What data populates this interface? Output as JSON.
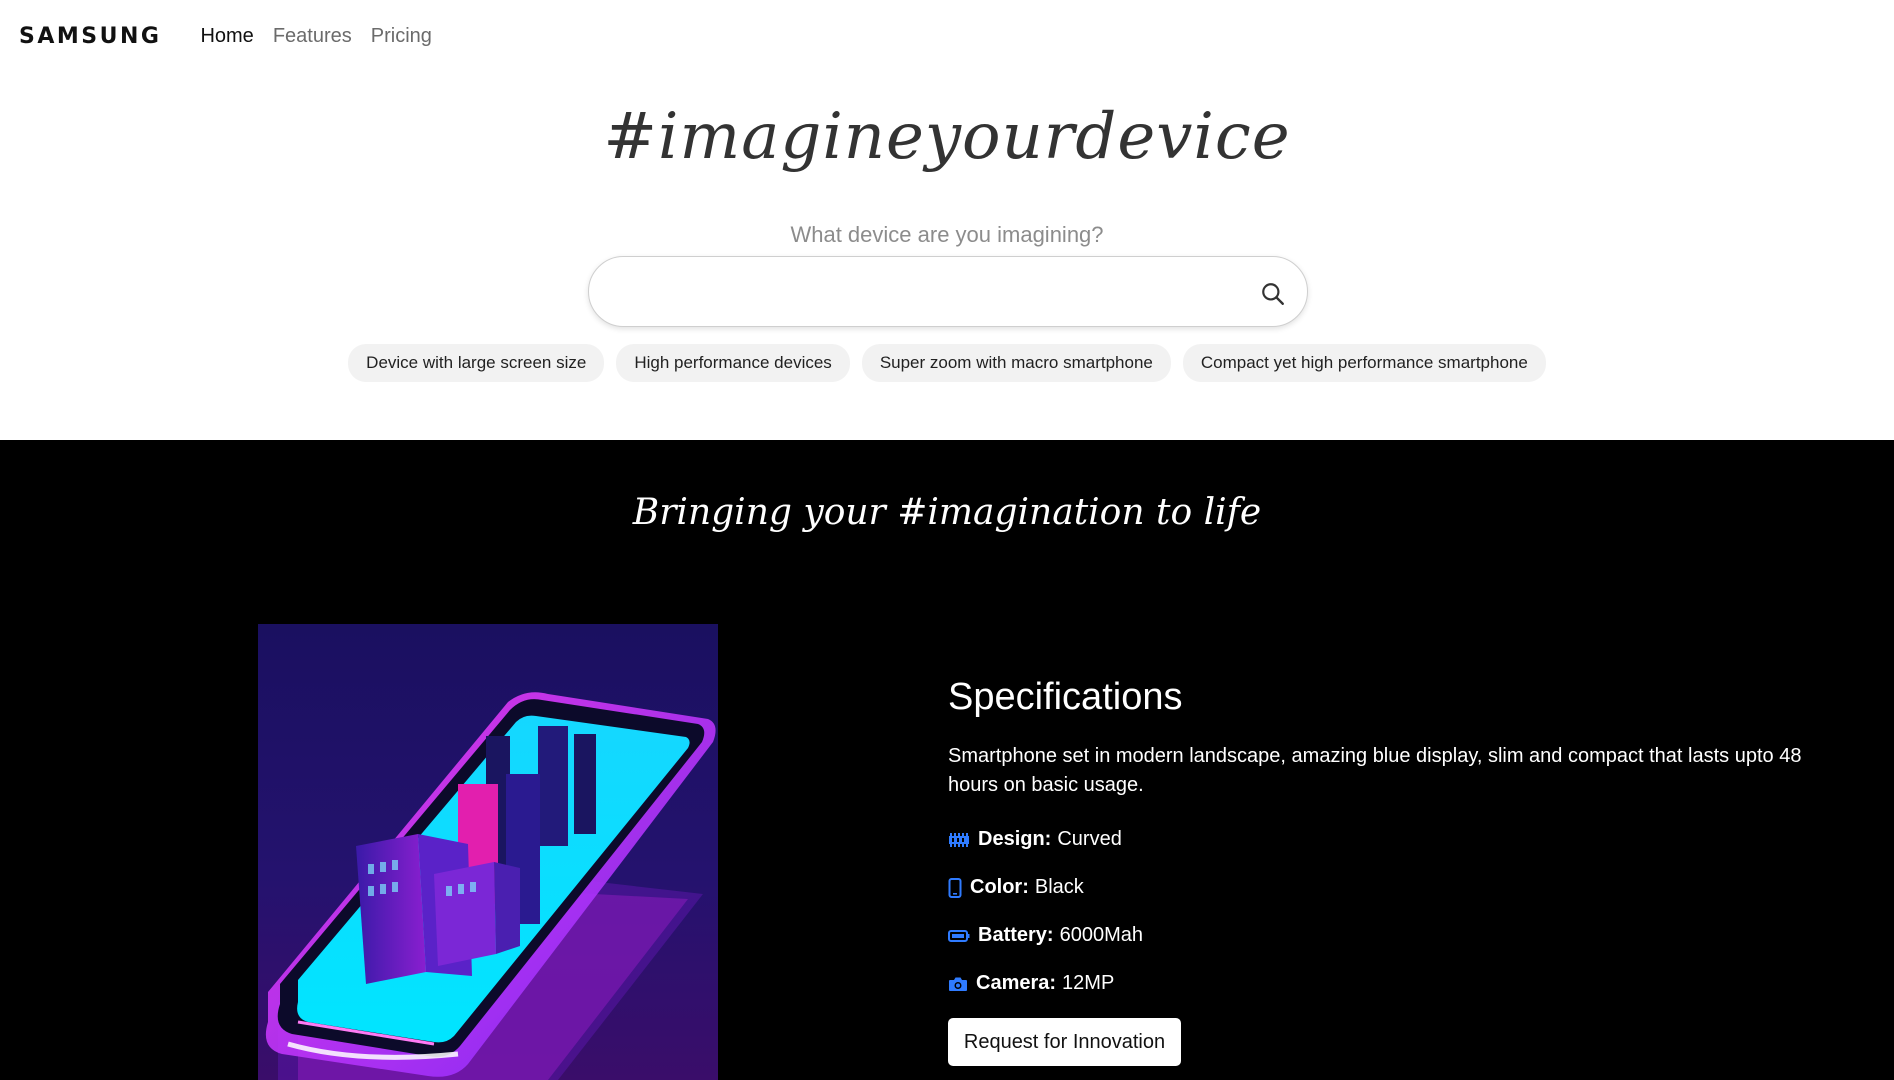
{
  "nav": {
    "logo": "SAMSUNG",
    "links": [
      "Home",
      "Features",
      "Pricing"
    ]
  },
  "hero": {
    "title": "#imagineyourdevice",
    "subtitle": "What device are you imagining?",
    "search": {
      "value": "",
      "placeholder": ""
    },
    "chips": [
      "Device with large screen size",
      "High performance devices",
      "Super zoom with macro smartphone",
      "Compact yet high performance smartphone"
    ]
  },
  "showcase": {
    "title": "Bringing your #imagination to life",
    "specs_title": "Specifications",
    "description": "Smartphone set in modern landscape, amazing blue display, slim and compact that lasts upto 48 hours on basic usage.",
    "specs": [
      {
        "label": "Design:",
        "value": "Curved",
        "icon": "memory-icon"
      },
      {
        "label": "Color:",
        "value": "Black",
        "icon": "phone-icon"
      },
      {
        "label": "Battery:",
        "value": "6000Mah",
        "icon": "battery-icon"
      },
      {
        "label": "Camera:",
        "value": "12MP",
        "icon": "camera-icon"
      }
    ],
    "cta": "Request for Innovation"
  },
  "colors": {
    "accent_blue": "#1a73e8",
    "dark_bg": "#000000",
    "chip_bg": "#f2f2f2"
  }
}
